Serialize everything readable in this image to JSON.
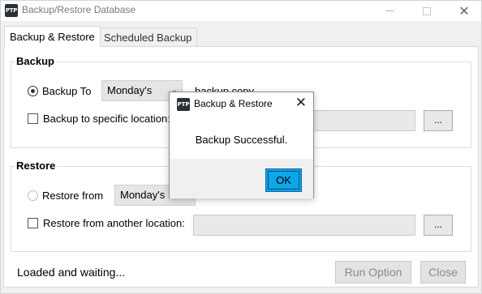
{
  "window": {
    "app_icon_text": "PTP",
    "title": "Backup/Restore Database",
    "close_glyph": "✕"
  },
  "tabs": [
    {
      "label": "Backup & Restore",
      "active": true
    },
    {
      "label": "Scheduled Backup",
      "active": false
    }
  ],
  "backup": {
    "title": "Backup",
    "backup_to_label": "Backup To",
    "backup_to_selected": true,
    "day_value": "Monday's",
    "suffix_text": "backup copy",
    "specific_label": "Backup to specific location:",
    "specific_checked": false,
    "specific_path": "",
    "browse_label": "..."
  },
  "restore": {
    "title": "Restore",
    "restore_from_label": "Restore from",
    "restore_from_selected": false,
    "day_value": "Monday's",
    "another_label": "Restore from another location:",
    "another_checked": false,
    "another_path": "",
    "browse_label": "..."
  },
  "status_text": "Loaded and waiting...",
  "buttons": {
    "run_option": "Run Option",
    "close": "Close"
  },
  "dialog": {
    "icon_text": "PTP",
    "title": "Backup & Restore",
    "message": "Backup Successful.",
    "ok_label": "OK",
    "close_glyph": "✕"
  },
  "colors": {
    "ok_button": "#0ea5e9",
    "window_bg": "#f0f0f0"
  }
}
